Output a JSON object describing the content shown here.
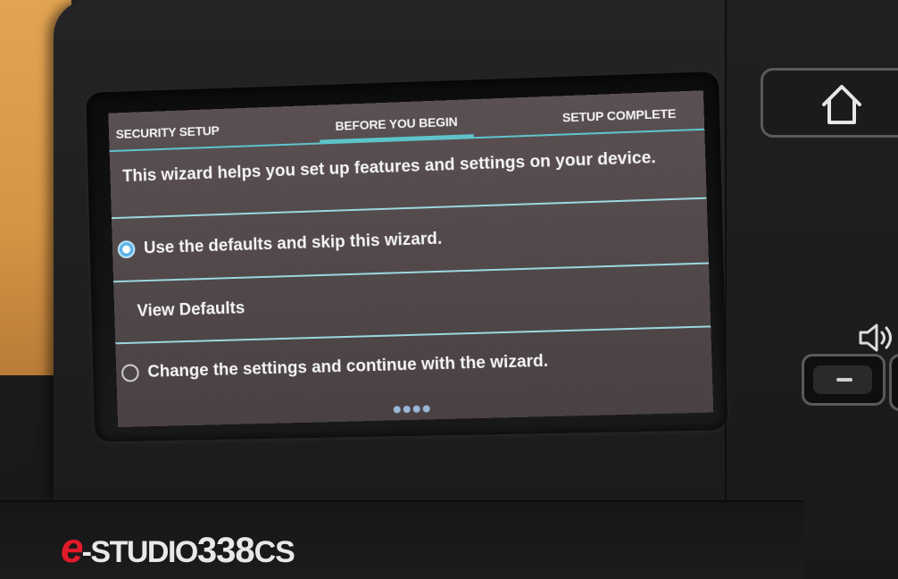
{
  "tabs": [
    {
      "label": "SECURITY SETUP",
      "active": false
    },
    {
      "label": "BEFORE YOU BEGIN",
      "active": true
    },
    {
      "label": "SETUP COMPLETE",
      "active": false
    }
  ],
  "intro_text": "This wizard helps you set up features and settings on your device.",
  "options": {
    "use_defaults": {
      "label": "Use the defaults and skip this wizard.",
      "selected": true
    },
    "view_defaults": {
      "label": "View Defaults"
    },
    "change_settings": {
      "label": "Change the settings and continue with the wizard.",
      "selected": false
    }
  },
  "page_indicator": {
    "count": 4
  },
  "device": {
    "brand_prefix": "e",
    "brand_name": "-STUDIO",
    "model_number": "338",
    "model_suffix": "CS"
  },
  "colors": {
    "accent": "#5ec4cc",
    "radio_selected": "#5ab3e8",
    "screen_bg": "#4f4648",
    "brand_red": "#e21a2a"
  },
  "icons": {
    "home": "home-icon",
    "volume": "speaker-volume-icon",
    "volume_down": "minus-icon"
  }
}
